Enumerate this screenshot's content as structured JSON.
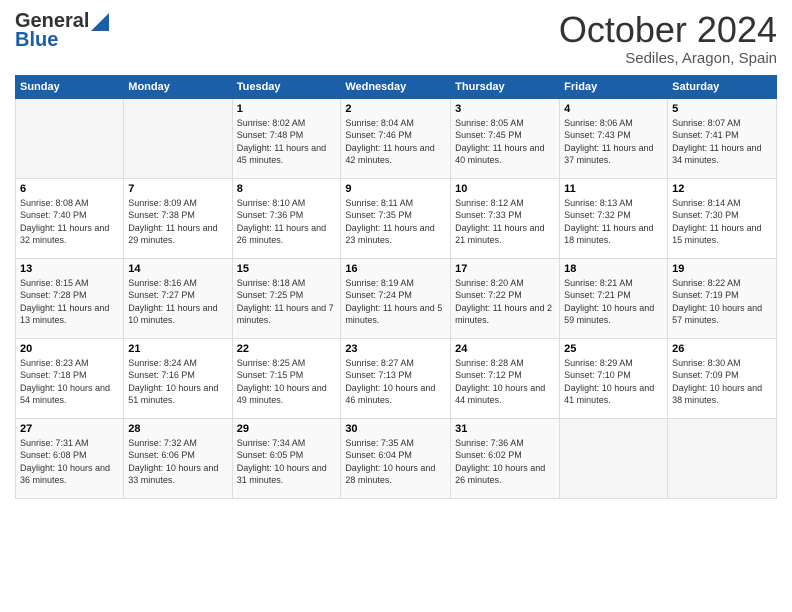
{
  "logo": {
    "line1": "General",
    "line2": "Blue"
  },
  "header": {
    "month": "October 2024",
    "location": "Sediles, Aragon, Spain"
  },
  "weekdays": [
    "Sunday",
    "Monday",
    "Tuesday",
    "Wednesday",
    "Thursday",
    "Friday",
    "Saturday"
  ],
  "weeks": [
    [
      {
        "day": "",
        "info": ""
      },
      {
        "day": "",
        "info": ""
      },
      {
        "day": "1",
        "info": "Sunrise: 8:02 AM\nSunset: 7:48 PM\nDaylight: 11 hours and 45 minutes."
      },
      {
        "day": "2",
        "info": "Sunrise: 8:04 AM\nSunset: 7:46 PM\nDaylight: 11 hours and 42 minutes."
      },
      {
        "day": "3",
        "info": "Sunrise: 8:05 AM\nSunset: 7:45 PM\nDaylight: 11 hours and 40 minutes."
      },
      {
        "day": "4",
        "info": "Sunrise: 8:06 AM\nSunset: 7:43 PM\nDaylight: 11 hours and 37 minutes."
      },
      {
        "day": "5",
        "info": "Sunrise: 8:07 AM\nSunset: 7:41 PM\nDaylight: 11 hours and 34 minutes."
      }
    ],
    [
      {
        "day": "6",
        "info": "Sunrise: 8:08 AM\nSunset: 7:40 PM\nDaylight: 11 hours and 32 minutes."
      },
      {
        "day": "7",
        "info": "Sunrise: 8:09 AM\nSunset: 7:38 PM\nDaylight: 11 hours and 29 minutes."
      },
      {
        "day": "8",
        "info": "Sunrise: 8:10 AM\nSunset: 7:36 PM\nDaylight: 11 hours and 26 minutes."
      },
      {
        "day": "9",
        "info": "Sunrise: 8:11 AM\nSunset: 7:35 PM\nDaylight: 11 hours and 23 minutes."
      },
      {
        "day": "10",
        "info": "Sunrise: 8:12 AM\nSunset: 7:33 PM\nDaylight: 11 hours and 21 minutes."
      },
      {
        "day": "11",
        "info": "Sunrise: 8:13 AM\nSunset: 7:32 PM\nDaylight: 11 hours and 18 minutes."
      },
      {
        "day": "12",
        "info": "Sunrise: 8:14 AM\nSunset: 7:30 PM\nDaylight: 11 hours and 15 minutes."
      }
    ],
    [
      {
        "day": "13",
        "info": "Sunrise: 8:15 AM\nSunset: 7:28 PM\nDaylight: 11 hours and 13 minutes."
      },
      {
        "day": "14",
        "info": "Sunrise: 8:16 AM\nSunset: 7:27 PM\nDaylight: 11 hours and 10 minutes."
      },
      {
        "day": "15",
        "info": "Sunrise: 8:18 AM\nSunset: 7:25 PM\nDaylight: 11 hours and 7 minutes."
      },
      {
        "day": "16",
        "info": "Sunrise: 8:19 AM\nSunset: 7:24 PM\nDaylight: 11 hours and 5 minutes."
      },
      {
        "day": "17",
        "info": "Sunrise: 8:20 AM\nSunset: 7:22 PM\nDaylight: 11 hours and 2 minutes."
      },
      {
        "day": "18",
        "info": "Sunrise: 8:21 AM\nSunset: 7:21 PM\nDaylight: 10 hours and 59 minutes."
      },
      {
        "day": "19",
        "info": "Sunrise: 8:22 AM\nSunset: 7:19 PM\nDaylight: 10 hours and 57 minutes."
      }
    ],
    [
      {
        "day": "20",
        "info": "Sunrise: 8:23 AM\nSunset: 7:18 PM\nDaylight: 10 hours and 54 minutes."
      },
      {
        "day": "21",
        "info": "Sunrise: 8:24 AM\nSunset: 7:16 PM\nDaylight: 10 hours and 51 minutes."
      },
      {
        "day": "22",
        "info": "Sunrise: 8:25 AM\nSunset: 7:15 PM\nDaylight: 10 hours and 49 minutes."
      },
      {
        "day": "23",
        "info": "Sunrise: 8:27 AM\nSunset: 7:13 PM\nDaylight: 10 hours and 46 minutes."
      },
      {
        "day": "24",
        "info": "Sunrise: 8:28 AM\nSunset: 7:12 PM\nDaylight: 10 hours and 44 minutes."
      },
      {
        "day": "25",
        "info": "Sunrise: 8:29 AM\nSunset: 7:10 PM\nDaylight: 10 hours and 41 minutes."
      },
      {
        "day": "26",
        "info": "Sunrise: 8:30 AM\nSunset: 7:09 PM\nDaylight: 10 hours and 38 minutes."
      }
    ],
    [
      {
        "day": "27",
        "info": "Sunrise: 7:31 AM\nSunset: 6:08 PM\nDaylight: 10 hours and 36 minutes."
      },
      {
        "day": "28",
        "info": "Sunrise: 7:32 AM\nSunset: 6:06 PM\nDaylight: 10 hours and 33 minutes."
      },
      {
        "day": "29",
        "info": "Sunrise: 7:34 AM\nSunset: 6:05 PM\nDaylight: 10 hours and 31 minutes."
      },
      {
        "day": "30",
        "info": "Sunrise: 7:35 AM\nSunset: 6:04 PM\nDaylight: 10 hours and 28 minutes."
      },
      {
        "day": "31",
        "info": "Sunrise: 7:36 AM\nSunset: 6:02 PM\nDaylight: 10 hours and 26 minutes."
      },
      {
        "day": "",
        "info": ""
      },
      {
        "day": "",
        "info": ""
      }
    ]
  ]
}
